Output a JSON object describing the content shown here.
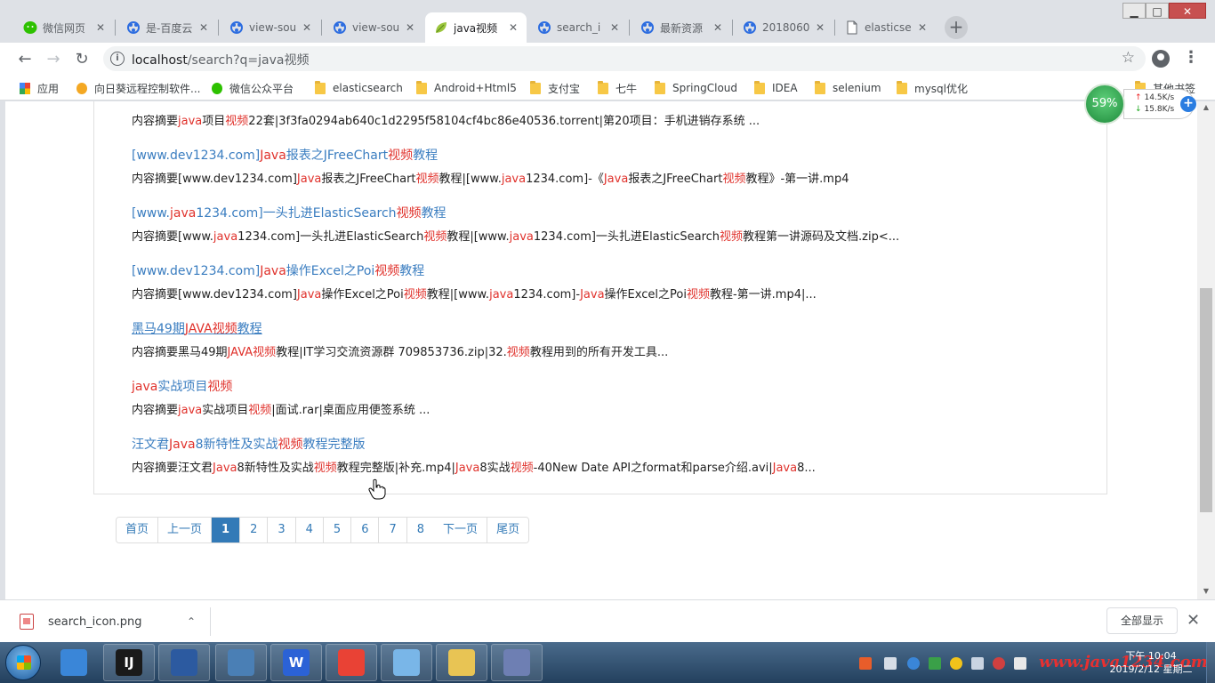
{
  "browser": {
    "tabs": [
      {
        "title": "微信网页",
        "favicon": "wechat-icon",
        "active": false
      },
      {
        "title": "是-百度云",
        "favicon": "baidu-paw-icon",
        "active": false
      },
      {
        "title": "view-sou",
        "favicon": "baidu-paw-icon",
        "active": false
      },
      {
        "title": "view-sou",
        "favicon": "baidu-paw-icon",
        "active": false
      },
      {
        "title": "java视频",
        "favicon": "leaf-icon",
        "active": true
      },
      {
        "title": "search_i",
        "favicon": "baidu-paw-icon",
        "active": false
      },
      {
        "title": "最新资源",
        "favicon": "baidu-paw-icon",
        "active": false
      },
      {
        "title": "2018060",
        "favicon": "baidu-paw-icon",
        "active": false
      },
      {
        "title": "elasticse",
        "favicon": "page-icon",
        "active": false
      }
    ],
    "new_tab": "+",
    "window_controls": {
      "minimize": "▁",
      "maximize": "□",
      "close": "✕"
    },
    "url_host": "localhost",
    "url_path": "/search?q=java视频",
    "bookmarks": [
      {
        "label": "应用",
        "icon": "apps-grid-icon"
      },
      {
        "label": "向日葵远程控制软件...",
        "icon": "sunflower-icon"
      },
      {
        "label": "微信公众平台",
        "icon": "wechat-icon"
      },
      {
        "label": "elasticsearch",
        "icon": "folder-icon"
      },
      {
        "label": "Android+Html5",
        "icon": "folder-icon"
      },
      {
        "label": "支付宝",
        "icon": "folder-icon"
      },
      {
        "label": "七牛",
        "icon": "folder-icon"
      },
      {
        "label": "SpringCloud",
        "icon": "folder-icon"
      },
      {
        "label": "IDEA",
        "icon": "folder-icon"
      },
      {
        "label": "selenium",
        "icon": "folder-icon"
      },
      {
        "label": "mysql优化",
        "icon": "folder-icon"
      },
      {
        "label": "其他书签",
        "icon": "folder-icon"
      }
    ]
  },
  "netmon": {
    "percent": "59%",
    "upload": "14.5K/s",
    "download": "15.8K/s"
  },
  "results": [
    {
      "title": null,
      "desc": [
        [
          "内容摘要",
          false
        ],
        [
          "java",
          true
        ],
        [
          "项目",
          false
        ],
        [
          "视频",
          true
        ],
        [
          "22套|3f3fa0294ab640c1d2295f58104cf4bc86e40536.torrent|第20项目：手机进销存系统 ...",
          false
        ]
      ]
    },
    {
      "title": [
        [
          "[www.dev1234.com]",
          false
        ],
        [
          "Java",
          true
        ],
        [
          "报表之JFreeChart",
          false
        ],
        [
          "视频",
          true
        ],
        [
          "教程",
          false
        ]
      ],
      "desc": [
        [
          "内容摘要[www.dev1234.com]",
          false
        ],
        [
          "Java",
          true
        ],
        [
          "报表之JFreeChart",
          false
        ],
        [
          "视频",
          true
        ],
        [
          "教程|[www.",
          false
        ],
        [
          "java",
          true
        ],
        [
          "1234.com]-《",
          false
        ],
        [
          "Java",
          true
        ],
        [
          "报表之JFreeChart",
          false
        ],
        [
          "视频",
          true
        ],
        [
          "教程》-第一讲.mp4",
          false
        ]
      ]
    },
    {
      "title": [
        [
          "[www.",
          false
        ],
        [
          "java",
          true
        ],
        [
          "1234.com]一头扎进ElasticSearch",
          false
        ],
        [
          "视频",
          true
        ],
        [
          "教程",
          false
        ]
      ],
      "desc": [
        [
          "内容摘要[www.",
          false
        ],
        [
          "java",
          true
        ],
        [
          "1234.com]一头扎进ElasticSearch",
          false
        ],
        [
          "视频",
          true
        ],
        [
          "教程|[www.",
          false
        ],
        [
          "java",
          true
        ],
        [
          "1234.com]一头扎进ElasticSearch",
          false
        ],
        [
          "视频",
          true
        ],
        [
          "教程第一讲源码及文档.zip<...",
          false
        ]
      ]
    },
    {
      "title": [
        [
          "[www.dev1234.com]",
          false
        ],
        [
          "Java",
          true
        ],
        [
          "操作Excel之Poi",
          false
        ],
        [
          "视频",
          true
        ],
        [
          "教程",
          false
        ]
      ],
      "desc": [
        [
          "内容摘要[www.dev1234.com]",
          false
        ],
        [
          "Java",
          true
        ],
        [
          "操作Excel之Poi",
          false
        ],
        [
          "视频",
          true
        ],
        [
          "教程|[www.",
          false
        ],
        [
          "java",
          true
        ],
        [
          "1234.com]-",
          false
        ],
        [
          "Java",
          true
        ],
        [
          "操作Excel之Poi",
          false
        ],
        [
          "视频",
          true
        ],
        [
          "教程-第一讲.mp4|...",
          false
        ]
      ]
    },
    {
      "title": [
        [
          "黑马49期",
          false
        ],
        [
          "JAVA",
          true
        ],
        [
          "视频",
          true
        ],
        [
          "教程",
          false
        ]
      ],
      "visited": true,
      "desc": [
        [
          "内容摘要黑马49期",
          false
        ],
        [
          "JAVA",
          true
        ],
        [
          "视频",
          true
        ],
        [
          "教程|IT学习交流资源群 709853736.zip|32.",
          false
        ],
        [
          "视频",
          true
        ],
        [
          "教程用到的所有开发工具...",
          false
        ]
      ]
    },
    {
      "title": [
        [
          "java",
          true
        ],
        [
          "实战项目",
          false
        ],
        [
          "视频",
          true
        ]
      ],
      "desc": [
        [
          "内容摘要",
          false
        ],
        [
          "java",
          true
        ],
        [
          "实战项目",
          false
        ],
        [
          "视频",
          true
        ],
        [
          "|面试.rar|桌面应用便签系统 ...",
          false
        ]
      ]
    },
    {
      "title": [
        [
          "汪文君",
          false
        ],
        [
          "Java",
          true
        ],
        [
          "8新特性及实战",
          false
        ],
        [
          "视频",
          true
        ],
        [
          "教程完整版",
          false
        ]
      ],
      "desc": [
        [
          "内容摘要汪文君",
          false
        ],
        [
          "Java",
          true
        ],
        [
          "8新特性及实战",
          false
        ],
        [
          "视频",
          true
        ],
        [
          "教程完整版|补充.mp4|",
          false
        ],
        [
          "Java",
          true
        ],
        [
          "8实战",
          false
        ],
        [
          "视频",
          true
        ],
        [
          "-40New Date API之format和parse介绍.avi|",
          false
        ],
        [
          "Java",
          true
        ],
        [
          "8...",
          false
        ]
      ]
    }
  ],
  "pagination": {
    "first": "首页",
    "prev": "上一页",
    "pages": [
      "1",
      "2",
      "3",
      "4",
      "5",
      "6",
      "7",
      "8"
    ],
    "active_page": "1",
    "next": "下一页",
    "last": "尾页"
  },
  "downloads": {
    "filename": "search_icon.png",
    "show_all": "全部显示",
    "close": "✕"
  },
  "taskbar": {
    "apps": [
      {
        "name": "photo-viewer-icon",
        "label": "",
        "color": "#3a86d8",
        "open": false
      },
      {
        "name": "intellij-icon",
        "label": "IJ",
        "color": "#1a1a1a",
        "open": true
      },
      {
        "name": "virtualbox-icon",
        "label": "",
        "color": "#2c5aa0",
        "open": true
      },
      {
        "name": "remote-desktop-icon",
        "label": "",
        "color": "#4a7fb5",
        "open": true
      },
      {
        "name": "wps-icon",
        "label": "W",
        "color": "#2b62d6",
        "open": true
      },
      {
        "name": "chrome-icon",
        "label": "",
        "color": "#e94235",
        "open": true
      },
      {
        "name": "notepad-icon",
        "label": "",
        "color": "#79b6e8",
        "open": true
      },
      {
        "name": "explorer-icon",
        "label": "",
        "color": "#e8c454",
        "open": true
      },
      {
        "name": "dolphin-icon",
        "label": "",
        "color": "#6e7fb3",
        "open": true
      }
    ],
    "watermark": "www.java1234.com",
    "time": "下午 10:04",
    "date": "2019/2/12 星期二"
  }
}
